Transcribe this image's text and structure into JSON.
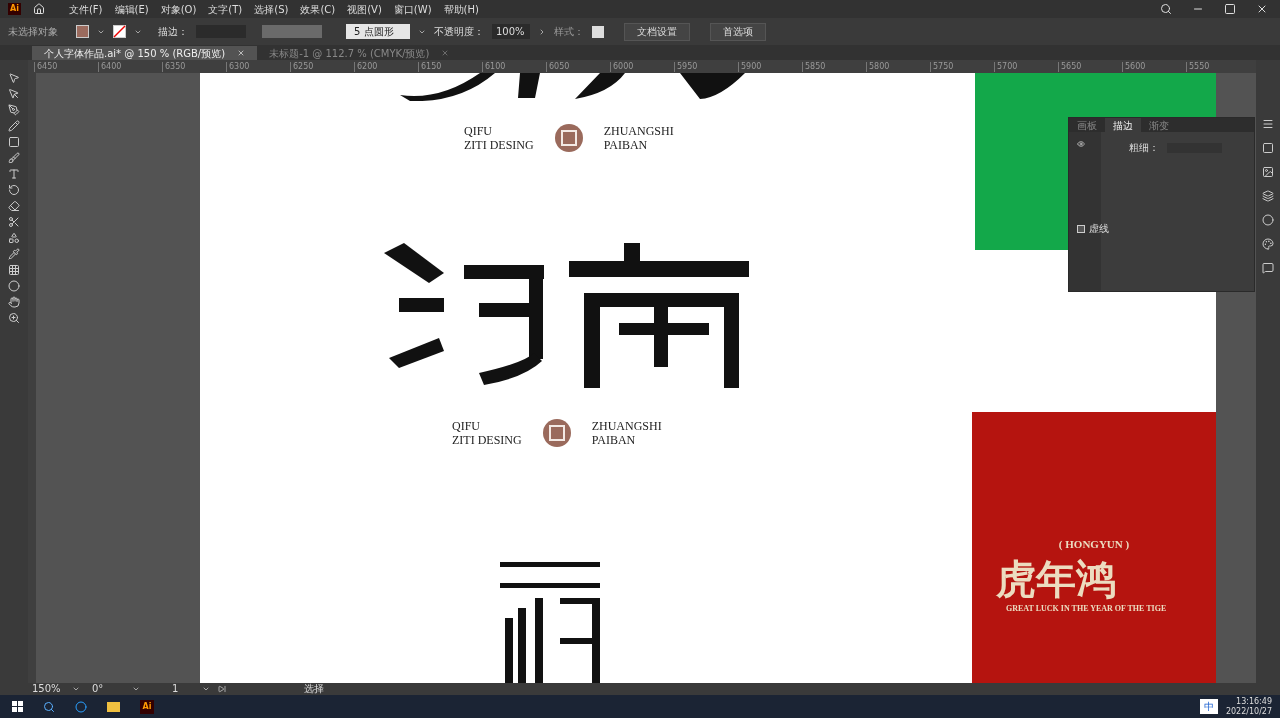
{
  "menu_bar": {
    "app_badge": "Ai",
    "items": [
      "文件(F)",
      "编辑(E)",
      "对象(O)",
      "文字(T)",
      "选择(S)",
      "效果(C)",
      "视图(V)",
      "窗口(W)",
      "帮助(H)"
    ]
  },
  "control_bar": {
    "selection": "未选择对象",
    "stroke_label": "描边：",
    "brush": "5 点圆形",
    "opacity_label": "不透明度：",
    "opacity": "100%",
    "style_label": "样式：",
    "buttons": [
      "文档设置",
      "首选项"
    ]
  },
  "tabs": [
    {
      "label": "个人字体作品.ai* @ 150 % (RGB/预览)",
      "selected": true
    },
    {
      "label": "未标题-1 @ 112.7 % (CMYK/预览)",
      "selected": false
    }
  ],
  "ruler": [
    "6450",
    "6400",
    "6350",
    "6300",
    "6250",
    "6200",
    "6150",
    "6100",
    "6050",
    "6000",
    "5950",
    "5900",
    "5850",
    "5800",
    "5750",
    "5700",
    "5650",
    "5600",
    "5550"
  ],
  "logos": [
    {
      "left": [
        "QIFU",
        "ZITI DESING"
      ],
      "right": [
        "ZHUANGSHI",
        "PAIBAN"
      ]
    },
    {
      "left": [
        "QIFU",
        "ZITI DESING"
      ],
      "right": [
        "ZHUANGSHI",
        "PAIBAN"
      ]
    }
  ],
  "poster": {
    "tag": "( HONGYUN )",
    "headline": "虎年鸿",
    "tagline": "GREAT LUCK IN THE YEAR OF THE TIGE"
  },
  "panel": {
    "tabs": [
      {
        "label": "画板",
        "selected": false
      },
      {
        "label": "描边",
        "selected": true
      },
      {
        "label": "渐变",
        "selected": false
      }
    ],
    "weight_label": "粗细：",
    "dashed_label": "虚线",
    "dashed": false
  },
  "status_bar": {
    "zoom": "150%",
    "rotation": "0°",
    "artboard": "1",
    "tool": "选择"
  },
  "taskbar": {
    "app_badge": "Ai",
    "ime": "中",
    "time": "13:16:49",
    "date": "2022/10/27"
  }
}
